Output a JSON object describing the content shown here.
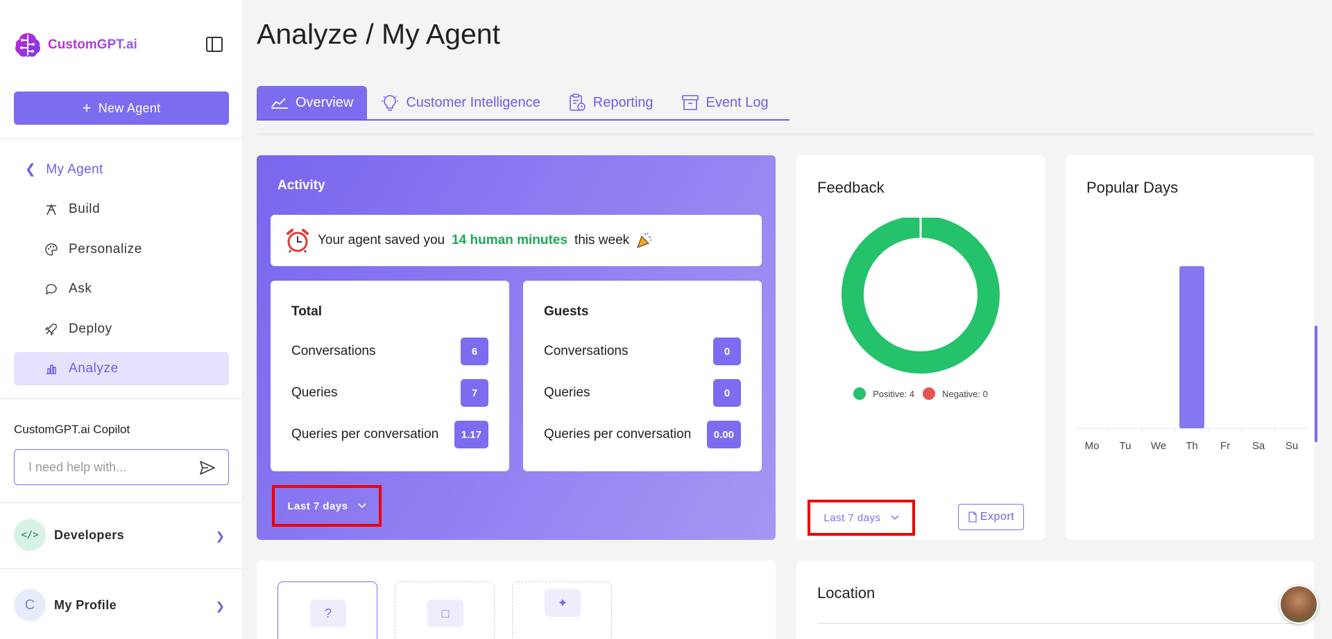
{
  "sidebar": {
    "logo_text": "CustomGPT.ai",
    "new_agent_label": "New Agent",
    "back_label": "My Agent",
    "items": [
      {
        "label": "Build",
        "icon": "build-icon"
      },
      {
        "label": "Personalize",
        "icon": "palette-icon"
      },
      {
        "label": "Ask",
        "icon": "chat-icon"
      },
      {
        "label": "Deploy",
        "icon": "rocket-icon"
      },
      {
        "label": "Analyze",
        "icon": "bar-chart-icon",
        "active": true
      }
    ],
    "copilot_title": "CustomGPT.ai Copilot",
    "copilot_placeholder": "I need help with...",
    "developers_label": "Developers",
    "profile_initial": "C",
    "profile_label": "My Profile"
  },
  "header": {
    "title": "Analyze / My Agent"
  },
  "tabs": [
    {
      "label": "Overview",
      "active": true
    },
    {
      "label": "Customer Intelligence"
    },
    {
      "label": "Reporting"
    },
    {
      "label": "Event Log"
    }
  ],
  "activity": {
    "title": "Activity",
    "saved_prefix": "Your agent saved you",
    "saved_highlight": "14 human minutes",
    "saved_suffix": "this week",
    "total": {
      "title": "Total",
      "rows": [
        {
          "label": "Conversations",
          "value": "6"
        },
        {
          "label": "Queries",
          "value": "7"
        },
        {
          "label": "Queries per conversation",
          "value": "1.17"
        }
      ]
    },
    "guests": {
      "title": "Guests",
      "rows": [
        {
          "label": "Conversations",
          "value": "0"
        },
        {
          "label": "Queries",
          "value": "0"
        },
        {
          "label": "Queries per conversation",
          "value": "0.00"
        }
      ]
    },
    "range_label": "Last 7 days"
  },
  "feedback": {
    "title": "Feedback",
    "positive_label": "Positive: 4",
    "negative_label": "Negative: 0",
    "range_label": "Last 7 days",
    "export_label": "Export"
  },
  "popular_days": {
    "title": "Popular Days"
  },
  "location": {
    "title": "Location"
  },
  "colors": {
    "accent": "#7b6cf0",
    "positive": "#24c26a",
    "negative": "#e85252",
    "highlight_red": "#e00000"
  },
  "chart_data": [
    {
      "type": "pie",
      "labels": [
        "Positive",
        "Negative"
      ],
      "values": [
        4,
        0
      ],
      "colors": [
        "#24c26a",
        "#e85252"
      ],
      "legend": "bottom"
    },
    {
      "type": "bar",
      "categories": [
        "Mo",
        "Tu",
        "We",
        "Th",
        "Fr",
        "Sa",
        "Su"
      ],
      "values": [
        0,
        0,
        0,
        1,
        0,
        0,
        0
      ],
      "grid": false
    }
  ]
}
